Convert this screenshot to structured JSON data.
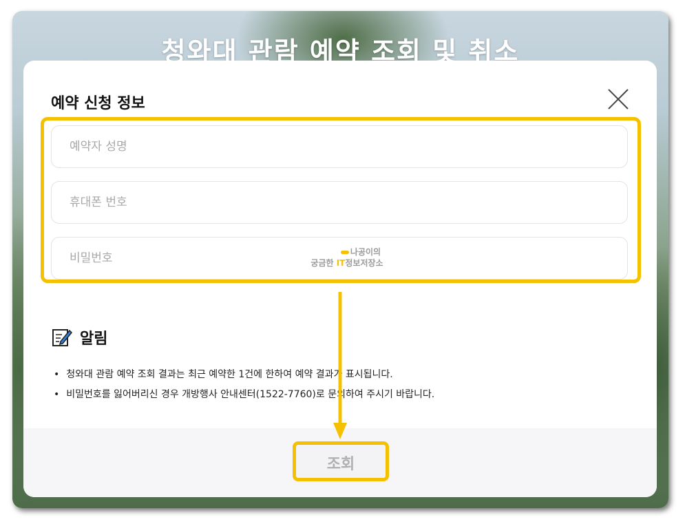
{
  "page": {
    "title": "청와대 관람 예약 조회 및 취소"
  },
  "modal": {
    "title": "예약 신청 정보",
    "close_icon": "close-icon",
    "fields": [
      {
        "name": "reserver-name-field",
        "placeholder": "예약자 성명",
        "value": ""
      },
      {
        "name": "phone-field",
        "placeholder": "휴대폰 번호",
        "value": ""
      },
      {
        "name": "password-field",
        "placeholder": "비밀번호",
        "value": ""
      }
    ],
    "watermark": {
      "line1": "나공이의",
      "line2a": "궁금한 ",
      "line2b": "IT",
      "line2c": "정보저장소"
    },
    "notice": {
      "icon": "memo-pencil-icon",
      "heading": "알림",
      "items": [
        "청와대 관람 예약 조회 결과는 최근 예약한 1건에 한하여 예약 결과가 표시됩니다.",
        "비밀번호를 잃어버리신 경우 개방행사 안내센터(1522-7760)로 문의하여 주시기 바랍니다."
      ]
    },
    "submit_label": "조회"
  },
  "colors": {
    "highlight": "#f5c000",
    "button_text": "#b0b0b0",
    "footer_bg": "#f6f6f8"
  }
}
